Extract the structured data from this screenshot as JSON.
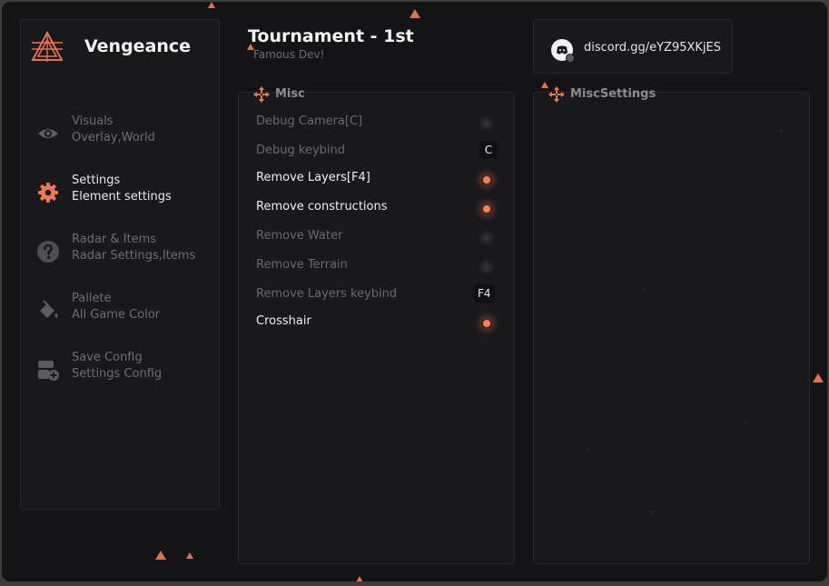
{
  "app": {
    "brand": "Vengeance"
  },
  "header": {
    "title": "Tournament - 1st",
    "subtitle": "Famous Dev!"
  },
  "discord": {
    "link": "discord.gg/eYZ95XKjES"
  },
  "sidebar": {
    "items": [
      {
        "title": "Visuals",
        "subtitle": "Overlay,World",
        "icon": "eye-icon",
        "active": false
      },
      {
        "title": "Settings",
        "subtitle": "Element settings",
        "icon": "gear-icon",
        "active": true
      },
      {
        "title": "Radar & Items",
        "subtitle": "Radar Settings,Items",
        "icon": "question-icon",
        "active": false
      },
      {
        "title": "Pallete",
        "subtitle": "All Game Color",
        "icon": "paint-bucket-icon",
        "active": false
      },
      {
        "title": "Save Config",
        "subtitle": "Settings Config",
        "icon": "config-add-icon",
        "active": false
      }
    ]
  },
  "panels": {
    "misc": {
      "title": "Misc",
      "rows": [
        {
          "label": "Debug Camera[C]",
          "type": "toggle",
          "on": false
        },
        {
          "label": "Debug keybind",
          "type": "key",
          "key": "C"
        },
        {
          "label": "Remove Layers[F4]",
          "type": "toggle",
          "on": true
        },
        {
          "label": "Remove constructions",
          "type": "toggle",
          "on": true
        },
        {
          "label": "Remove Water",
          "type": "toggle",
          "on": false
        },
        {
          "label": "Remove Terrain",
          "type": "toggle",
          "on": false
        },
        {
          "label": "Remove Layers keybind",
          "type": "key",
          "key": "F4"
        },
        {
          "label": "Crosshair",
          "type": "toggle",
          "on": true
        }
      ]
    },
    "misc_settings": {
      "title": "MiscSettings"
    }
  },
  "colors": {
    "accent": "#ff7b57",
    "background": "#141416",
    "panel": "#19191c"
  }
}
